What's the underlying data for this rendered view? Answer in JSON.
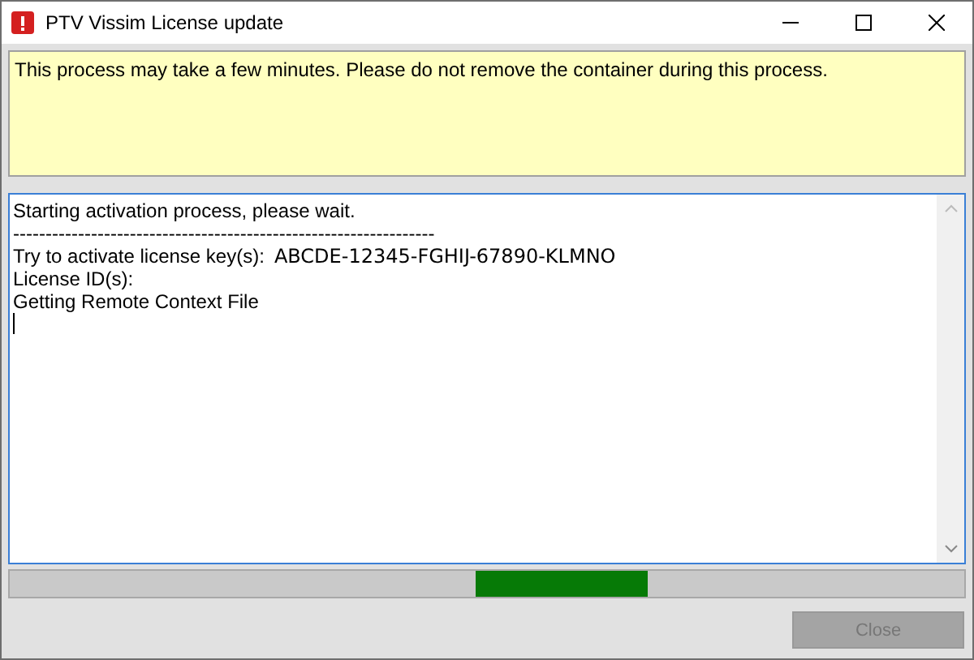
{
  "window": {
    "title": "PTV Vissim License update"
  },
  "notice": "This process may take a few minutes. Please do not remove the container during this process.",
  "log": {
    "lines": [
      {
        "kind": "text",
        "text": "Starting activation process, please wait."
      },
      {
        "kind": "text",
        "text": "-----------------------------------------------------------------"
      },
      {
        "kind": "key",
        "label": "Try to activate license key(s):",
        "value": "ABCDE-12345-FGHIJ-67890-KLMNO"
      },
      {
        "kind": "text",
        "text": "License ID(s):"
      },
      {
        "kind": "text",
        "text": "Getting Remote Context File"
      }
    ]
  },
  "progress": {
    "kind": "marquee"
  },
  "buttons": [
    {
      "label": "Close",
      "disabled": true
    }
  ]
}
